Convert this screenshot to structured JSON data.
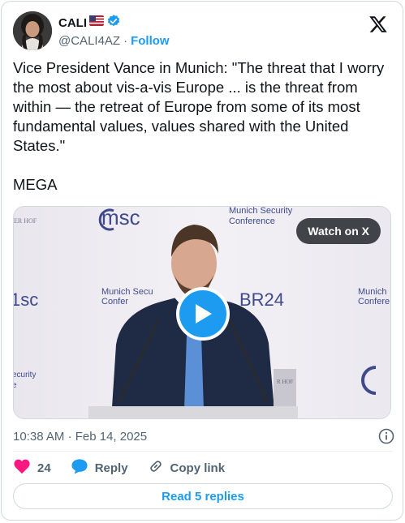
{
  "author": {
    "display_name": "CALI",
    "handle": "@CALI4AZ",
    "separator": "·",
    "follow_label": "Follow",
    "verified_color": "#1d9bf0"
  },
  "tweet": {
    "text": "Vice President Vance in Munich: \"The threat that I worry the most about vis-a-vis Europe ... is the threat from within — the retreat of Europe from some of its most fundamental values, values shared with the United States.\"\n\nMEGA"
  },
  "media": {
    "watch_label": "Watch on X",
    "backdrop": {
      "top_logo": "msc",
      "top_title_1": "Munich Security",
      "top_title_2": "Conference",
      "left_fragment_1": "ER HOF",
      "left_logo": "1sc",
      "left_title_1": "Munich Secu",
      "left_title_2": "Confer",
      "center_logo": "BR24",
      "right_title_1": "Munich",
      "right_title_2": "Confere",
      "left_bottom_1": "ecurity",
      "left_bottom_2": "e",
      "podium_fragment": "R HOF"
    }
  },
  "meta": {
    "timestamp": "10:38 AM · Feb 14, 2025"
  },
  "actions": {
    "like_count": "24",
    "reply_label": "Reply",
    "copy_label": "Copy link"
  },
  "read_replies_label": "Read 5 replies",
  "colors": {
    "accent": "#1d9bf0",
    "like": "#f91880",
    "muted": "#536471"
  },
  "icons": [
    "x-logo-icon",
    "verified-badge-icon",
    "flag-icon",
    "play-icon",
    "info-icon",
    "heart-icon",
    "reply-bubble-icon",
    "link-icon"
  ]
}
